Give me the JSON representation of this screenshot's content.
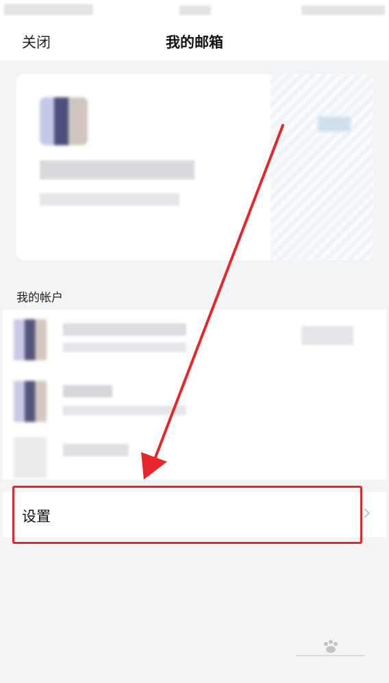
{
  "nav": {
    "close_label": "关闭",
    "title": "我的邮箱"
  },
  "accounts_section": {
    "label": "我的帐户"
  },
  "settings": {
    "label": "设置"
  },
  "annotation": {
    "color": "#e8262a"
  },
  "icons": {
    "chevron": "chevron-right-icon",
    "watermark": "baidu-jingyan-watermark"
  }
}
